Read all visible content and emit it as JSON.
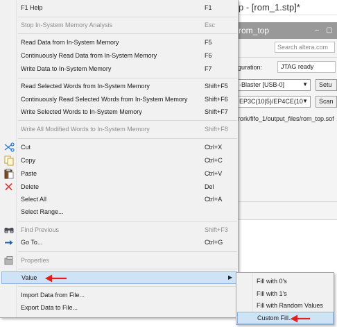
{
  "window": {
    "title": "p - [rom_1.stp]*",
    "doc_tab": "rom_top",
    "search_placeholder": "Search altera.com",
    "config_label": "guration:",
    "config_value": "JTAG ready",
    "hardware_select": "-Blaster [USB-0]",
    "device_select": "EP3C(10|5)/EP4CE(10",
    "setup_button": "Setu",
    "scan_button": "Scan",
    "file_path": "rork/fifo_1/output_files/rom_top.sof"
  },
  "menu": {
    "items": [
      {
        "label": "F1 Help",
        "shortcut": "F1",
        "enabled": true
      },
      {
        "label": "Stop In-System Memory Analysis",
        "shortcut": "Esc",
        "enabled": false
      },
      {
        "label": "Read Data from In-System Memory",
        "shortcut": "F5",
        "enabled": true
      },
      {
        "label": "Continuously Read Data from In-System Memory",
        "shortcut": "F6",
        "enabled": true
      },
      {
        "label": "Write Data to In-System Memory",
        "shortcut": "F7",
        "enabled": true
      },
      {
        "label": "Read Selected Words from In-System Memory",
        "shortcut": "Shift+F5",
        "enabled": true
      },
      {
        "label": "Continuously Read Selected Words from In-System Memory",
        "shortcut": "Shift+F6",
        "enabled": true
      },
      {
        "label": "Write Selected Words to In-System Memory",
        "shortcut": "Shift+F7",
        "enabled": true
      },
      {
        "label": "Write All Modified Words to In-System Memory",
        "shortcut": "Shift+F8",
        "enabled": false
      },
      {
        "label": "Cut",
        "shortcut": "Ctrl+X",
        "enabled": true,
        "icon": "scissors-icon"
      },
      {
        "label": "Copy",
        "shortcut": "Ctrl+C",
        "enabled": true,
        "icon": "copy-icon"
      },
      {
        "label": "Paste",
        "shortcut": "Ctrl+V",
        "enabled": true,
        "icon": "paste-icon"
      },
      {
        "label": "Delete",
        "shortcut": "Del",
        "enabled": true,
        "icon": "delete-icon"
      },
      {
        "label": "Select All",
        "shortcut": "Ctrl+A",
        "enabled": true
      },
      {
        "label": "Select Range...",
        "shortcut": "",
        "enabled": true
      },
      {
        "label": "Find Previous",
        "shortcut": "Shift+F3",
        "enabled": false,
        "icon": "binoculars-icon"
      },
      {
        "label": "Go To...",
        "shortcut": "Ctrl+G",
        "enabled": true,
        "icon": "goto-arrow-icon"
      },
      {
        "label": "Properties",
        "shortcut": "",
        "enabled": false,
        "icon": "properties-icon"
      },
      {
        "label": "Value",
        "shortcut": "",
        "enabled": true,
        "submenu": true,
        "highlighted": true
      },
      {
        "label": "Import Data from File...",
        "shortcut": "",
        "enabled": true
      },
      {
        "label": "Export Data to File...",
        "shortcut": "",
        "enabled": true
      }
    ]
  },
  "submenu": {
    "items": [
      {
        "label": "Fill with 0's"
      },
      {
        "label": "Fill with 1's"
      },
      {
        "label": "Fill with Random Values"
      },
      {
        "label": "Custom Fill...",
        "highlighted": true
      }
    ]
  },
  "colors": {
    "menu_bg": "#f1f1f1",
    "highlight_bg": "#cfe3f7",
    "highlight_border": "#8fb6e3",
    "annotation_arrow": "#e02020",
    "disabled_text": "#8d8d8d"
  }
}
